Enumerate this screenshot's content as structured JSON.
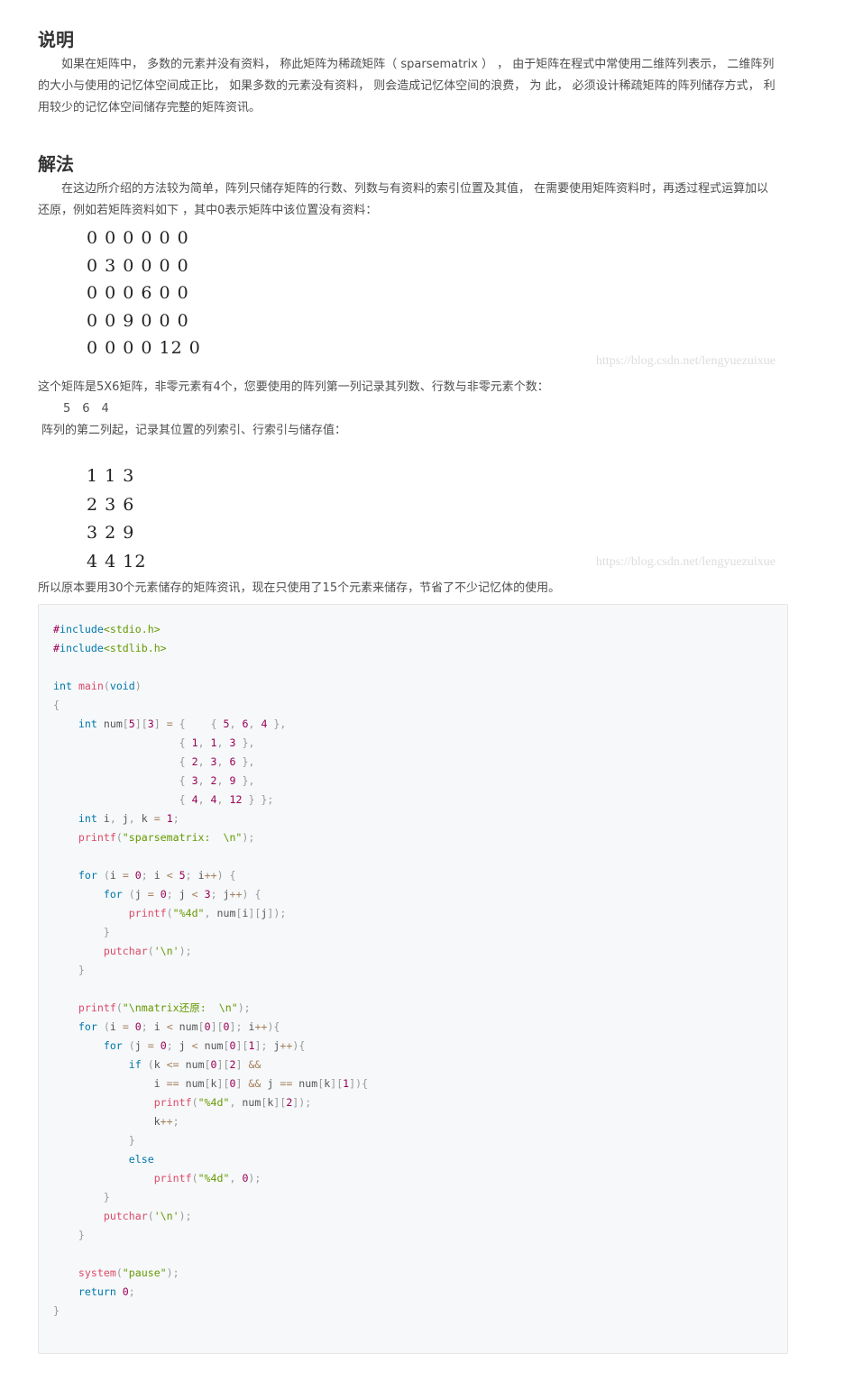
{
  "section1": {
    "title": "说明",
    "text": "　　如果在矩阵中， 多数的元素并没有资料， 称此矩阵为稀疏矩阵（ sparsematrix ） ， 由于矩阵在程式中常使用二维阵列表示， 二维阵列的大小与使用的记忆体空间成正比， 如果多数的元素没有资料， 则会造成记忆体空间的浪费， 为 此， 必须设计稀疏矩阵的阵列储存方式， 利用较少的记忆体空间储存完整的矩阵资讯。"
  },
  "section2": {
    "title": "解法",
    "text": "　　在这边所介绍的方法较为简单，阵列只储存矩阵的行数、列数与有资料的索引位置及其值， 在需要使用矩阵资料时，再透过程式运算加以还原，例如若矩阵资料如下 ，其中0表示矩阵中该位置没有资料："
  },
  "matrix": [
    "0 0 0 0 0 0",
    "0 3 0 0 0 0",
    "0 0 0 6 0 0",
    "0 0 9 0 0 0",
    "0 0 0 0 12 0"
  ],
  "watermark": "https://blog.csdn.net/lengyuezuixue",
  "para3": "这个矩阵是5X6矩阵，非零元素有4个，您要使用的阵列第一列记录其列数、行数与非零元素个数：",
  "first_row": "5　6　4",
  "para4": "阵列的第二列起，记录其位置的列索引、行索引与储存值：",
  "sparse": [
    "1 1 3",
    "2 3 6",
    "3 2 9",
    "4 4 12"
  ],
  "para5": "所以原本要用30个元素储存的矩阵资讯，现在只使用了15个元素来储存，节省了不少记忆体的使用。",
  "code": [
    "#include<stdio.h>",
    "#include<stdlib.h>",
    "",
    "int main(void)",
    "{",
    "    int num[5][3] = {    { 5, 6, 4 },",
    "                    { 1, 1, 3 },",
    "                    { 2, 3, 6 },",
    "                    { 3, 2, 9 },",
    "                    { 4, 4, 12 } };",
    "    int i, j, k = 1;",
    "    printf(\"sparsematrix:  \\n\");",
    "",
    "    for (i = 0; i < 5; i++) {",
    "        for (j = 0; j < 3; j++) {",
    "            printf(\"%4d\", num[i][j]);",
    "        }",
    "        putchar('\\n');",
    "    }",
    "",
    "    printf(\"\\nmatrix还原:  \\n\");",
    "    for (i = 0; i < num[0][0]; i++){",
    "        for (j = 0; j < num[0][1]; j++){",
    "            if (k <= num[0][2] &&",
    "                i == num[k][0] && j == num[k][1]){",
    "                printf(\"%4d\", num[k][2]);",
    "                k++;",
    "            }",
    "            else",
    "                printf(\"%4d\", 0);",
    "        }",
    "        putchar('\\n');",
    "    }",
    "",
    "    system(\"pause\");",
    "    return 0;",
    "}"
  ],
  "colors": {
    "keyword": "#0077aa",
    "function": "#dd4a68",
    "string": "#669900",
    "number": "#990055",
    "punctuation": "#999999",
    "operator": "#a67f59"
  }
}
